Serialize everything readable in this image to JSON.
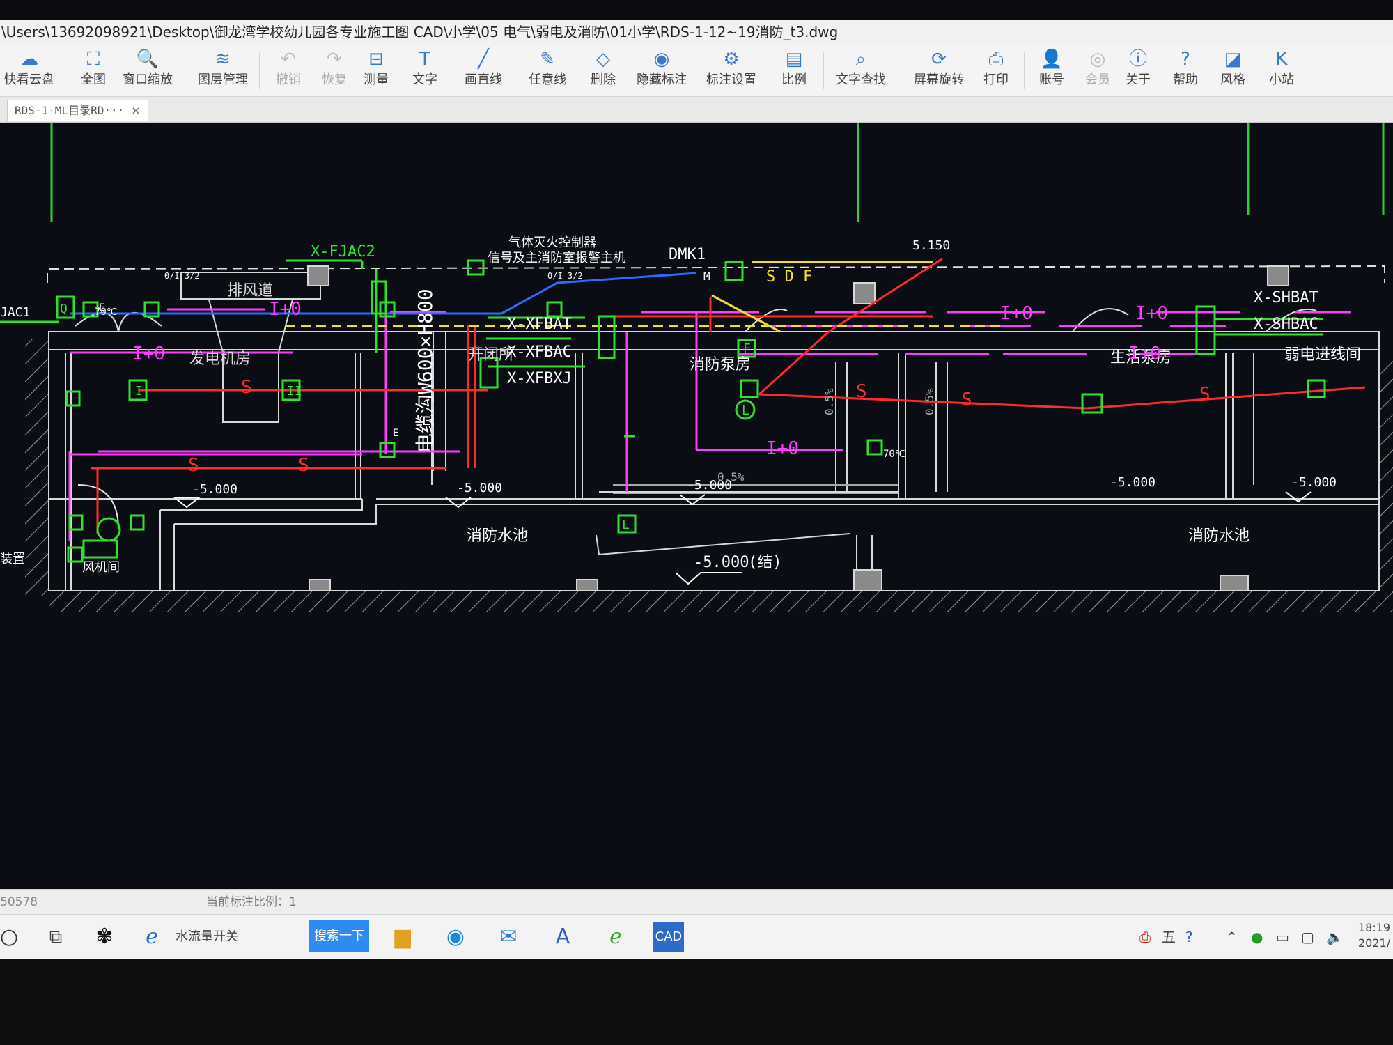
{
  "window": {
    "title": "\\Users\\13692098921\\Desktop\\御龙湾学校幼儿园各专业施工图 CAD\\小学\\05 电气\\弱电及消防\\01小学\\RDS-1-12~19消防_t3.dwg"
  },
  "toolbar": [
    {
      "id": "cloud",
      "label": "快看云盘",
      "icon": "cloud-icon",
      "glyph": "☁",
      "disabled": false
    },
    {
      "id": "full",
      "label": "全图",
      "icon": "fullview-icon",
      "glyph": "⛶",
      "disabled": false
    },
    {
      "id": "zoom",
      "label": "窗口缩放",
      "icon": "zoom-window-icon",
      "glyph": "🔍",
      "disabled": false
    },
    {
      "id": "layers",
      "label": "图层管理",
      "icon": "layers-icon",
      "glyph": "≋",
      "disabled": false
    },
    {
      "id": "undo",
      "label": "撤销",
      "icon": "undo-icon",
      "glyph": "↶",
      "disabled": true
    },
    {
      "id": "redo",
      "label": "恢复",
      "icon": "redo-icon",
      "glyph": "↷",
      "disabled": true
    },
    {
      "id": "measure",
      "label": "测量",
      "icon": "measure-icon",
      "glyph": "⊟",
      "disabled": false
    },
    {
      "id": "text",
      "label": "文字",
      "icon": "text-icon",
      "glyph": "T",
      "disabled": false
    },
    {
      "id": "line",
      "label": "画直线",
      "icon": "line-icon",
      "glyph": "╱",
      "disabled": false
    },
    {
      "id": "freeline",
      "label": "任意线",
      "icon": "pen-icon",
      "glyph": "✎",
      "disabled": false
    },
    {
      "id": "delete",
      "label": "删除",
      "icon": "eraser-icon",
      "glyph": "◇",
      "disabled": false
    },
    {
      "id": "hide",
      "label": "隐藏标注",
      "icon": "hide-icon",
      "glyph": "◉",
      "disabled": false
    },
    {
      "id": "dimset",
      "label": "标注设置",
      "icon": "dim-settings-icon",
      "glyph": "⚙",
      "disabled": false
    },
    {
      "id": "ratio",
      "label": "比例",
      "icon": "scale-icon",
      "glyph": "▤",
      "disabled": false
    },
    {
      "id": "find",
      "label": "文字查找",
      "icon": "text-search-icon",
      "glyph": "⌕",
      "disabled": false
    },
    {
      "id": "rotate",
      "label": "屏幕旋转",
      "icon": "rotate-icon",
      "glyph": "⟳",
      "disabled": false
    },
    {
      "id": "print",
      "label": "打印",
      "icon": "print-icon",
      "glyph": "⎙",
      "disabled": false
    },
    {
      "id": "account",
      "label": "账号",
      "icon": "account-icon",
      "glyph": "👤",
      "disabled": false
    },
    {
      "id": "vip",
      "label": "会员",
      "icon": "vip-icon",
      "glyph": "◎",
      "disabled": true
    },
    {
      "id": "about",
      "label": "关于",
      "icon": "info-icon",
      "glyph": "ⓘ",
      "disabled": false
    },
    {
      "id": "help",
      "label": "帮助",
      "icon": "help-icon",
      "glyph": "?",
      "disabled": false
    },
    {
      "id": "style",
      "label": "风格",
      "icon": "style-icon",
      "glyph": "◪",
      "disabled": false
    },
    {
      "id": "station",
      "label": "小站",
      "icon": "station-icon",
      "glyph": "K",
      "disabled": false
    }
  ],
  "tabs": [
    {
      "label": "RDS-1-ML目录RD···",
      "close": "×"
    }
  ],
  "drawing": {
    "labels": {
      "xfjac2": "X-FJAC2",
      "paifeng": "排风道",
      "gas_ctrl": "气体灭火控制器",
      "gas_ctrl2": "信号及主消防室报警主机",
      "dmk1": "DMK1",
      "elev": "5.150",
      "sdf": "S D F",
      "fadian": "发电机房",
      "kaiguan": "开闭所",
      "cable": "电缆沟W600×H800",
      "xfbat": "X-XFBAT",
      "xfbac": "X-XFBAC",
      "xfbxj": "X-XFBXJ",
      "xf_pump": "消防泵房",
      "life_pump": "生活泵房",
      "weak": "弱电进线间",
      "shbat": "X-SHBAT",
      "shbac": "X-SHBAC",
      "pool1": "消防水池",
      "pool2": "消防水池",
      "lv1": "-5.000",
      "lv2": "-5.000",
      "lv3": "-5.000",
      "lv4": "-5.000",
      "lv5": "-5.000",
      "lv6": "-5.000",
      "lv_struct": "(结)",
      "jac1": "JAC1",
      "zhuang": "装置",
      "fengji": "风机间",
      "slope1": "0.5%",
      "slope2": "0.5%",
      "slope3": "0.5%",
      "deg70": "70℃",
      "flow": "I+0",
      "letter_s": "S",
      "letter_e": "E",
      "letter_l": "L",
      "letter_f": "F",
      "letter_m": "M",
      "letter_q": "Q",
      "letter_i": "I",
      "letter_ii": "II",
      "label_070": "0/I 3/2"
    }
  },
  "status": {
    "coord": "50578",
    "scale_text": "当前标注比例：1"
  },
  "taskbar": {
    "search_label": "搜索一下",
    "ie_label": "水流量开关",
    "clock_time": "18:19",
    "clock_date": "2021/",
    "ime": "五"
  }
}
